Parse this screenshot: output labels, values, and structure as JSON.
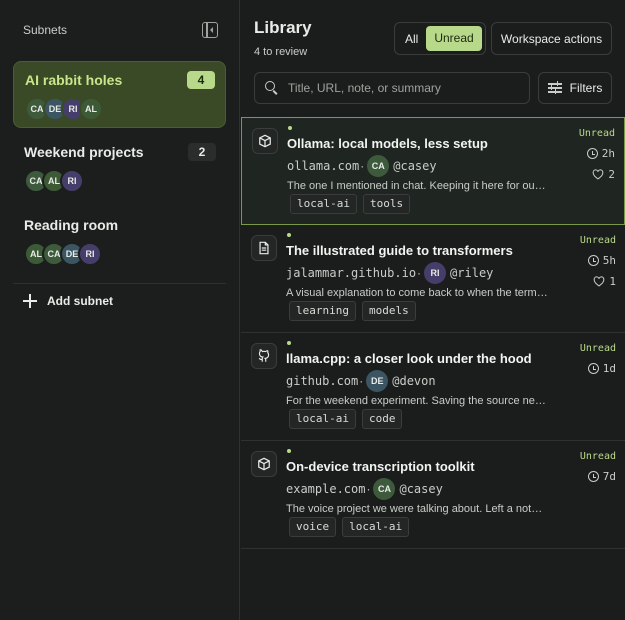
{
  "sidebar": {
    "title": "Subnets",
    "subnets": [
      {
        "name": "AI rabbit holes",
        "count": "4",
        "avatars": [
          "CA",
          "DE",
          "RI",
          "AL"
        ]
      },
      {
        "name": "Weekend projects",
        "count": "2",
        "avatars": [
          "CA",
          "AL",
          "RI"
        ]
      },
      {
        "name": "Reading room",
        "count": "",
        "avatars": [
          "AL",
          "CA",
          "DE",
          "RI"
        ]
      }
    ],
    "add_label": "Add subnet"
  },
  "main": {
    "title": "Library",
    "subtitle": "4 to review",
    "filter_all": "All",
    "filter_unread": "Unread",
    "workspace_actions": "Workspace actions",
    "search_placeholder": "Title, URL, note, or summary",
    "filters_label": "Filters"
  },
  "items": [
    {
      "title": "Ollama: local models, less setup",
      "domain": "ollama.com",
      "avatar": "CA",
      "user": "@casey",
      "note": "The one I mentioned in chat. Keeping it here for our local experiments.",
      "tags": [
        "local-ai",
        "tools"
      ],
      "status": "Unread",
      "time": "2h",
      "likes": "2",
      "icon": "package-icon"
    },
    {
      "title": "The illustrated guide to transformers",
      "domain": "jalammar.github.io",
      "avatar": "RI",
      "user": "@riley",
      "note": "A visual explanation to come back to when the terminology gets dense.",
      "tags": [
        "learning",
        "models"
      ],
      "status": "Unread",
      "time": "5h",
      "likes": "1",
      "icon": "document-icon"
    },
    {
      "title": "llama.cpp: a closer look under the hood",
      "domain": "github.com",
      "avatar": "DE",
      "user": "@devon",
      "note": "For the weekend experiment. Saving the source next to the others.",
      "tags": [
        "local-ai",
        "code"
      ],
      "status": "Unread",
      "time": "1d",
      "likes": "",
      "icon": "github-icon"
    },
    {
      "title": "On-device transcription toolkit",
      "domain": "example.com",
      "avatar": "CA",
      "user": "@casey",
      "note": "The voice project we were talking about. Left a note with the details.",
      "tags": [
        "voice",
        "local-ai"
      ],
      "status": "Unread",
      "time": "7d",
      "likes": "",
      "icon": "package-icon"
    }
  ]
}
